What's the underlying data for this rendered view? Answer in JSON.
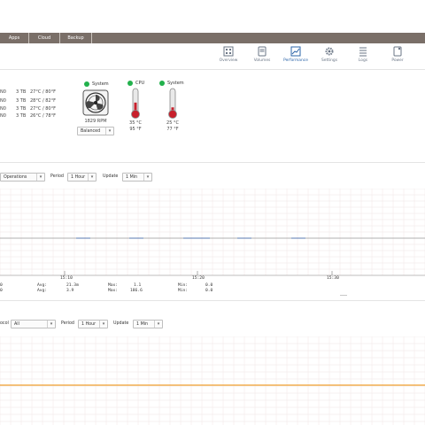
{
  "nav": {
    "tabs": [
      {
        "label": "Apps"
      },
      {
        "label": "Cloud"
      },
      {
        "label": "Backup"
      }
    ]
  },
  "toolbar": {
    "items": [
      {
        "label": "Overview",
        "icon": "overview-icon"
      },
      {
        "label": "Volumes",
        "icon": "volumes-icon"
      },
      {
        "label": "Performance",
        "icon": "performance-icon",
        "active": true
      },
      {
        "label": "Settings",
        "icon": "gear-icon"
      },
      {
        "label": "Logs",
        "icon": "logs-icon"
      },
      {
        "label": "Power",
        "icon": "power-icon"
      }
    ]
  },
  "disks": [
    {
      "id": "N0",
      "size": "3 TB",
      "temp": "27°C / 80°F"
    },
    {
      "id": "N0",
      "size": "3 TB",
      "temp": "28°C / 82°F"
    },
    {
      "id": "N0",
      "size": "3 TB",
      "temp": "27°C / 80°F"
    },
    {
      "id": "N0",
      "size": "3 TB",
      "temp": "26°C / 78°F"
    }
  ],
  "sensors": {
    "fan": {
      "label": "System",
      "rpm": "1829 RPM",
      "mode": "Balanced",
      "status_color": "#22b14c"
    },
    "cpu": {
      "label": "CPU",
      "c": "35 °C",
      "f": "95 °F",
      "level": 0.45
    },
    "system": {
      "label": "System",
      "c": "25 °C",
      "f": "77 °F",
      "level": 0.25
    }
  },
  "chart1": {
    "controls": {
      "metric": "Operations",
      "period_label": "Period",
      "period": "1 Hour",
      "update_label": "Update",
      "update": "1 Min"
    },
    "time_ticks": [
      "15:10",
      "15:20",
      "15:30"
    ],
    "stats": {
      "row1": {
        "cur": "0",
        "avg_label": "Avg:",
        "avg": "21.3m",
        "max_label": "Max:",
        "max": "1.1",
        "min_label": "Min:",
        "min": "0.0"
      },
      "row2": {
        "cur": "0",
        "avg_label": "Avg:",
        "avg": "3.9",
        "max_label": "Max:",
        "max": "186.6",
        "min_label": "Min:",
        "min": "0.0"
      }
    }
  },
  "chart2": {
    "controls": {
      "protocol_label": "ocol",
      "protocol": "All",
      "period_label": "Period",
      "period": "1 Hour",
      "update_label": "Update",
      "update": "1 Min"
    },
    "line_color": "#f0a030"
  },
  "chart_data": [
    {
      "type": "line",
      "x": [
        "15:10",
        "15:20",
        "15:30"
      ],
      "series": [
        {
          "values": [
            0.0,
            0.0,
            0.0,
            0.0,
            0.0
          ]
        }
      ]
    },
    {
      "type": "line",
      "series": [
        {
          "values": [
            0.0,
            0.0,
            0.0
          ]
        }
      ]
    }
  ]
}
